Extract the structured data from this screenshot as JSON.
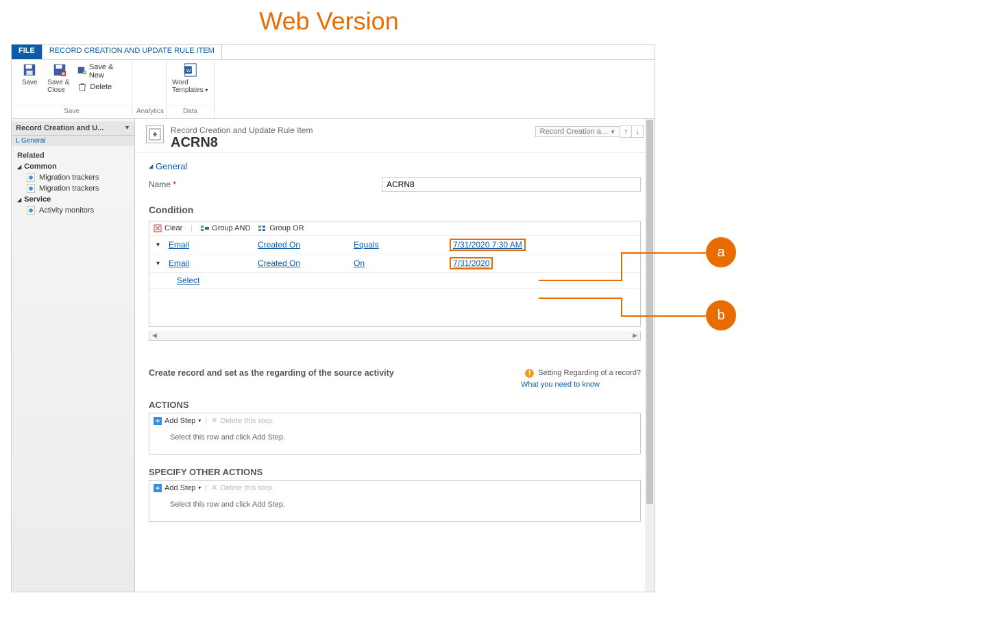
{
  "banner": "Web Version",
  "tabs": {
    "file": "FILE",
    "main": "RECORD CREATION AND UPDATE RULE ITEM"
  },
  "ribbon": {
    "save": {
      "save": "Save",
      "saveClose": "Save & Close",
      "saveNew": "Save & New",
      "delete": "Delete",
      "group": "Save"
    },
    "analytics": {
      "group": "Analytics"
    },
    "data": {
      "word": "Word Templates",
      "group": "Data"
    }
  },
  "sidebar": {
    "header": "Record Creation and U...",
    "generalLink": "General",
    "related": "Related",
    "groups": [
      {
        "name": "Common",
        "items": [
          "Migration trackers",
          "Migration trackers"
        ]
      },
      {
        "name": "Service",
        "items": [
          "Activity monitors"
        ]
      }
    ]
  },
  "record": {
    "breadcrumb": "Record Creation and Update Rule Item",
    "title": "ACRN8",
    "chip": "Record Creation a...",
    "section_general": "General",
    "name_label": "Name",
    "name_value": "ACRN8",
    "condition_label": "Condition",
    "cond_toolbar": {
      "clear": "Clear",
      "and": "Group AND",
      "or": "Group OR"
    },
    "cond_rows": [
      {
        "entity": "Email",
        "field": "Created On",
        "op": "Equals",
        "val": "7/31/2020 7:30 AM"
      },
      {
        "entity": "Email",
        "field": "Created On",
        "op": "On",
        "val": "7/31/2020"
      }
    ],
    "select": "Select",
    "create_text": "Create record and set as the regarding of the source activity",
    "setting_text": "Setting Regarding of a record?",
    "setting_link": "What you need to know",
    "actions": {
      "title": "ACTIONS",
      "add": "Add Step",
      "del": "Delete this step.",
      "empty": "Select this row and click Add Step."
    },
    "other": {
      "title": "SPECIFY OTHER ACTIONS",
      "add": "Add Step",
      "del": "Delete this step.",
      "empty": "Select this row and click Add Step."
    }
  },
  "annotations": {
    "a": "a",
    "b": "b"
  }
}
